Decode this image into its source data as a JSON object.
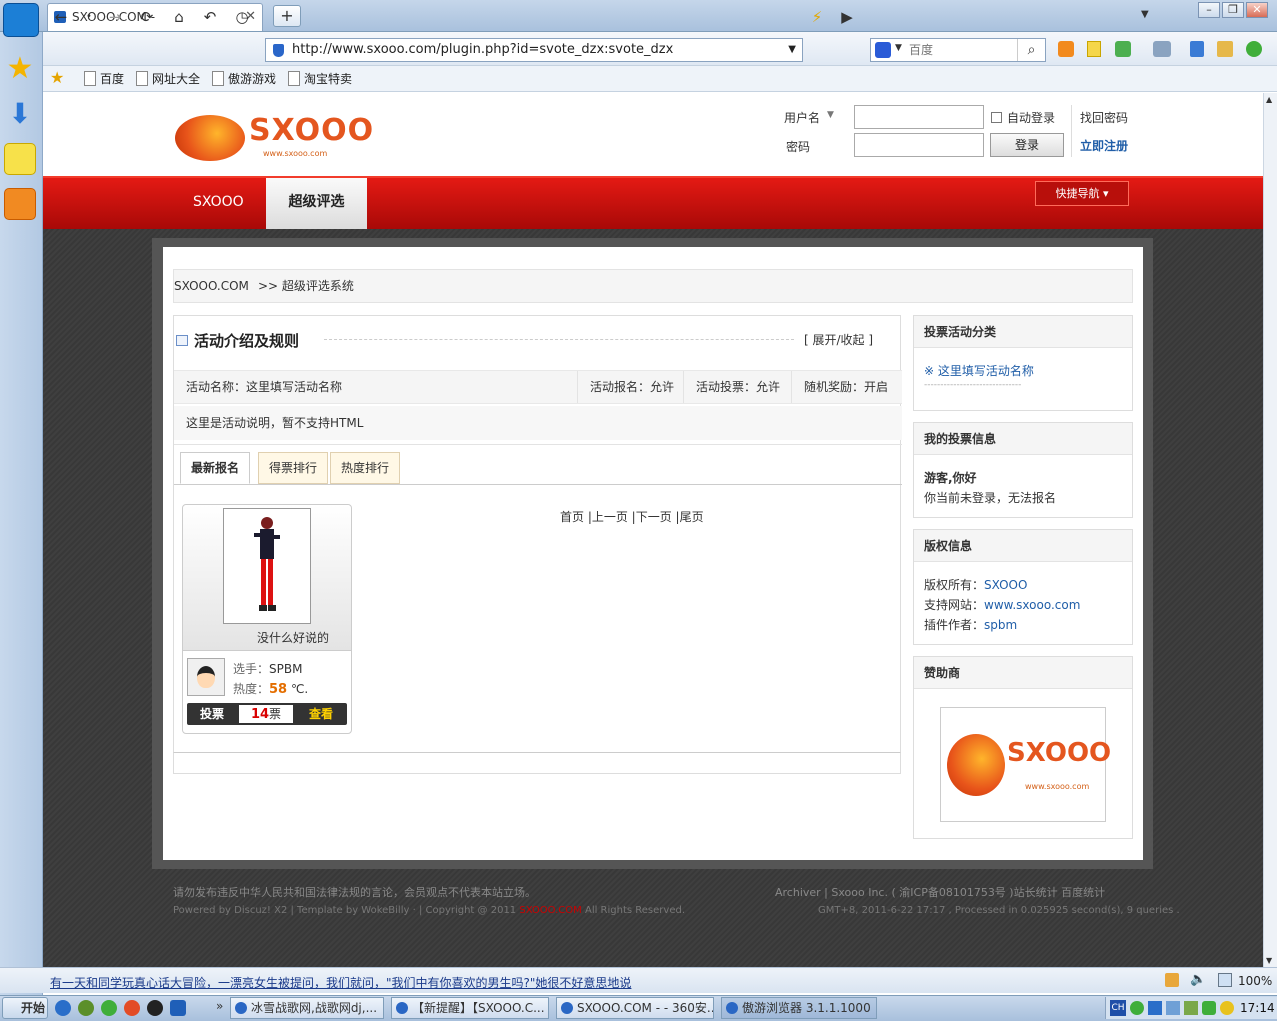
{
  "browser": {
    "tab_title": "SXOOO.COM -",
    "url": "http://www.sxooo.com/plugin.php?id=svote_dzx:svote_dzx",
    "search_placeholder": "百度",
    "favorites": [
      "百度",
      "网址大全",
      "傲游游戏",
      "淘宝特卖"
    ],
    "status_text": "有一天和同学玩真心话大冒险，一漂亮女生被提问，我们就问，\"我们中有你喜欢的男生吗?\"她很不好意思地说",
    "zoom": "100%"
  },
  "header": {
    "logo_text": "SXOOO",
    "logo_url": "www.sxooo.com",
    "username_label": "用户名",
    "password_label": "密码",
    "auto_login_label": "自动登录",
    "login_button": "登录",
    "find_password": "找回密码",
    "register": "立即注册"
  },
  "nav": {
    "items": [
      "SXOOO",
      "超级评选"
    ],
    "quick_nav": "快捷导航"
  },
  "breadcrumb": {
    "home": "SXOOO.COM",
    "current": ">> 超级评选系统"
  },
  "activity": {
    "title": "活动介绍及规则",
    "toggle": "[ 展开/收起 ]",
    "name": "活动名称：这里填写活动名称",
    "signup": "活动报名：允许",
    "voting": "活动投票：允许",
    "random_reward": "随机奖励：开启",
    "description": "这里是活动说明，暂不支持HTML",
    "tabs": [
      "最新报名",
      "得票排行",
      "热度排行"
    ],
    "pager": "首页 |上一页 |下一页 |尾页"
  },
  "entry": {
    "motto": "没什么好说的",
    "player_label": "选手：",
    "player_name": "SPBM",
    "heat_label": "热度：",
    "heat_value": "58",
    "heat_unit": "℃.",
    "vote_button": "投票",
    "vote_count": "14",
    "vote_unit": "票",
    "view_button": "查看"
  },
  "sidebar": {
    "category_title": "投票活动分类",
    "category_item": "※ 这里填写活动名称",
    "category_divider": "------------------------------",
    "myvote_title": "我的投票信息",
    "greeting": "游客,你好",
    "login_hint": "你当前未登录，无法报名",
    "copyright_title": "版权信息",
    "owner_label": "版权所有：",
    "owner": "SXOOO",
    "site_label": "支持网站：",
    "site": "www.sxooo.com",
    "author_label": "插件作者：",
    "author": "spbm",
    "sponsor_title": "赞助商",
    "sponsor_logo_text": "SXOOO",
    "sponsor_logo_url": "www.sxooo.com"
  },
  "footer": {
    "disclaimer": "请勿发布违反中华人民共和国法律法规的言论，会员观点不代表本站立场。",
    "powered": "Powered by Discuz! X2 | Template by WokeBilly · | Copyright @ 2011",
    "powered_brand": "SXOOO.COM",
    "powered_tail": "All Rights Reserved.",
    "right_links": "Archiver | Sxooo Inc. ( 渝ICP备08101753号 )站长统计 百度统计",
    "stats": "GMT+8, 2011-6-22 17:17 , Processed in 0.025925 second(s), 9 queries ."
  },
  "taskbar": {
    "start": "开始",
    "tasks": [
      "冰雪战歌网,战歌网dj,...",
      "【新提醒】【SXOOO.C...",
      "SXOOO.COM - - 360安...",
      "傲游浏览器 3.1.1.1000"
    ],
    "clock": "17:14"
  }
}
